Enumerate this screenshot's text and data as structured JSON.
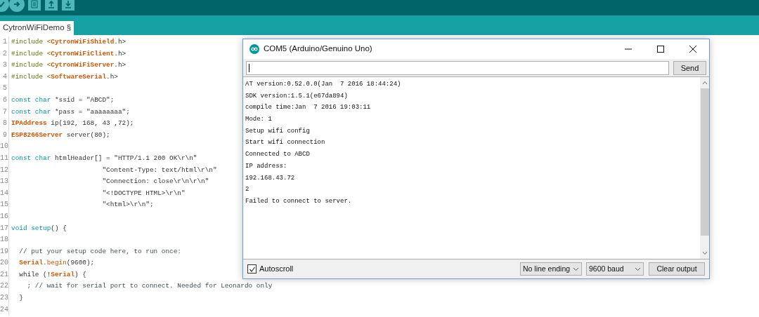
{
  "toolbar": {
    "buttons": [
      {
        "kind": "verify"
      },
      {
        "kind": "upload"
      },
      {
        "kind": "new"
      },
      {
        "kind": "open"
      },
      {
        "kind": "save"
      }
    ]
  },
  "tabs": [
    {
      "label": "CytronWiFiDemo §",
      "selected": true
    }
  ],
  "editor": {
    "lines": [
      {
        "number": "1",
        "segments": [
          {
            "text": "#include <",
            "kind": "directive"
          },
          {
            "text": "CytronWiFiShield",
            "kind": "class"
          },
          {
            "text": ".h>",
            "kind": "plain"
          }
        ]
      },
      {
        "number": "2",
        "segments": [
          {
            "text": "#include <",
            "kind": "directive"
          },
          {
            "text": "CytronWiFiClient",
            "kind": "class"
          },
          {
            "text": ".h>",
            "kind": "plain"
          }
        ]
      },
      {
        "number": "3",
        "segments": [
          {
            "text": "#include <",
            "kind": "directive"
          },
          {
            "text": "CytronWiFiServer",
            "kind": "class"
          },
          {
            "text": ".h>",
            "kind": "plain"
          }
        ]
      },
      {
        "number": "4",
        "segments": [
          {
            "text": "#include <",
            "kind": "directive"
          },
          {
            "text": "SoftwareSerial",
            "kind": "class"
          },
          {
            "text": ".h>",
            "kind": "plain"
          }
        ]
      },
      {
        "number": "5"
      },
      {
        "number": "6",
        "segments": [
          {
            "text": "const char",
            "kind": "keyword"
          },
          {
            "text": " *ssid = \"ABCD\";",
            "kind": "plain"
          }
        ]
      },
      {
        "number": "7",
        "segments": [
          {
            "text": "const char",
            "kind": "keyword"
          },
          {
            "text": " *pass = \"aaaaaaaa\";",
            "kind": "plain"
          }
        ]
      },
      {
        "number": "8",
        "segments": [
          {
            "text": "IPAddress",
            "kind": "class"
          },
          {
            "text": " ip(192, 168, 43 ,72);",
            "kind": "plain"
          }
        ]
      },
      {
        "number": "9",
        "segments": [
          {
            "text": "ESP8266Server",
            "kind": "class"
          },
          {
            "text": " server(80);",
            "kind": "plain"
          }
        ]
      },
      {
        "number": "10"
      },
      {
        "number": "11",
        "segments": [
          {
            "text": "const char",
            "kind": "keyword"
          },
          {
            "text": " htmlHeader[] = \"HTTP/1.1 200 OK\\r\\n\"",
            "kind": "plain"
          }
        ]
      },
      {
        "number": "12",
        "segments": [
          {
            "text": "                       \"Content-Type: text/html\\r\\n\"",
            "kind": "plain"
          }
        ]
      },
      {
        "number": "13",
        "segments": [
          {
            "text": "                       \"Connection: close\\r\\n\\r\\n\"",
            "kind": "plain"
          }
        ]
      },
      {
        "number": "14",
        "segments": [
          {
            "text": "                       \"<!DOCTYPE HTML>\\r\\n\"",
            "kind": "plain"
          }
        ]
      },
      {
        "number": "15",
        "segments": [
          {
            "text": "                       \"<html>\\r\\n\";",
            "kind": "plain"
          }
        ]
      },
      {
        "number": "16"
      },
      {
        "number": "17",
        "segments": [
          {
            "text": "void setup",
            "kind": "keyword"
          },
          {
            "text": "() {",
            "kind": "plain"
          }
        ]
      },
      {
        "number": "18"
      },
      {
        "number": "19",
        "segments": [
          {
            "text": "  // put your setup code here, to run once:",
            "kind": "comment"
          }
        ]
      },
      {
        "number": "20",
        "segments": [
          {
            "text": "  Serial",
            "kind": "class"
          },
          {
            "text": ".",
            "kind": "plain"
          },
          {
            "text": "begin",
            "kind": "function"
          },
          {
            "text": "(9600);",
            "kind": "plain"
          }
        ]
      },
      {
        "number": "21",
        "segments": [
          {
            "text": "  while (!",
            "kind": "plain"
          },
          {
            "text": "Serial",
            "kind": "class"
          },
          {
            "text": ") {",
            "kind": "plain"
          }
        ]
      },
      {
        "number": "22",
        "segments": [
          {
            "text": "    ; // wait for serial port to connect. Needed for Leonardo only",
            "kind": "comment"
          }
        ]
      },
      {
        "number": "23",
        "segments": [
          {
            "text": "  }",
            "kind": "plain"
          }
        ]
      },
      {
        "number": "24"
      }
    ]
  },
  "serial_monitor": {
    "title": "COM5 (Arduino/Genuino Uno)",
    "send_button": "Send",
    "output": [
      "AT version:0.52.0.0(Jan  7 2016 18:44:24)",
      "SDK version:1.5.1(e67da894)",
      "compile time:Jan  7 2016 19:03:11",
      "Mode: 1",
      "Setup wifi config",
      "Start wifi connection",
      "Connected to ABCD",
      "IP address:",
      "192.168.43.72",
      "2",
      "Failed to connect to server."
    ],
    "autoscroll": {
      "label": "Autoscroll",
      "checked": true
    },
    "line_ending": "No line ending",
    "baud": "9600 baud",
    "clear_button": "Clear output"
  }
}
